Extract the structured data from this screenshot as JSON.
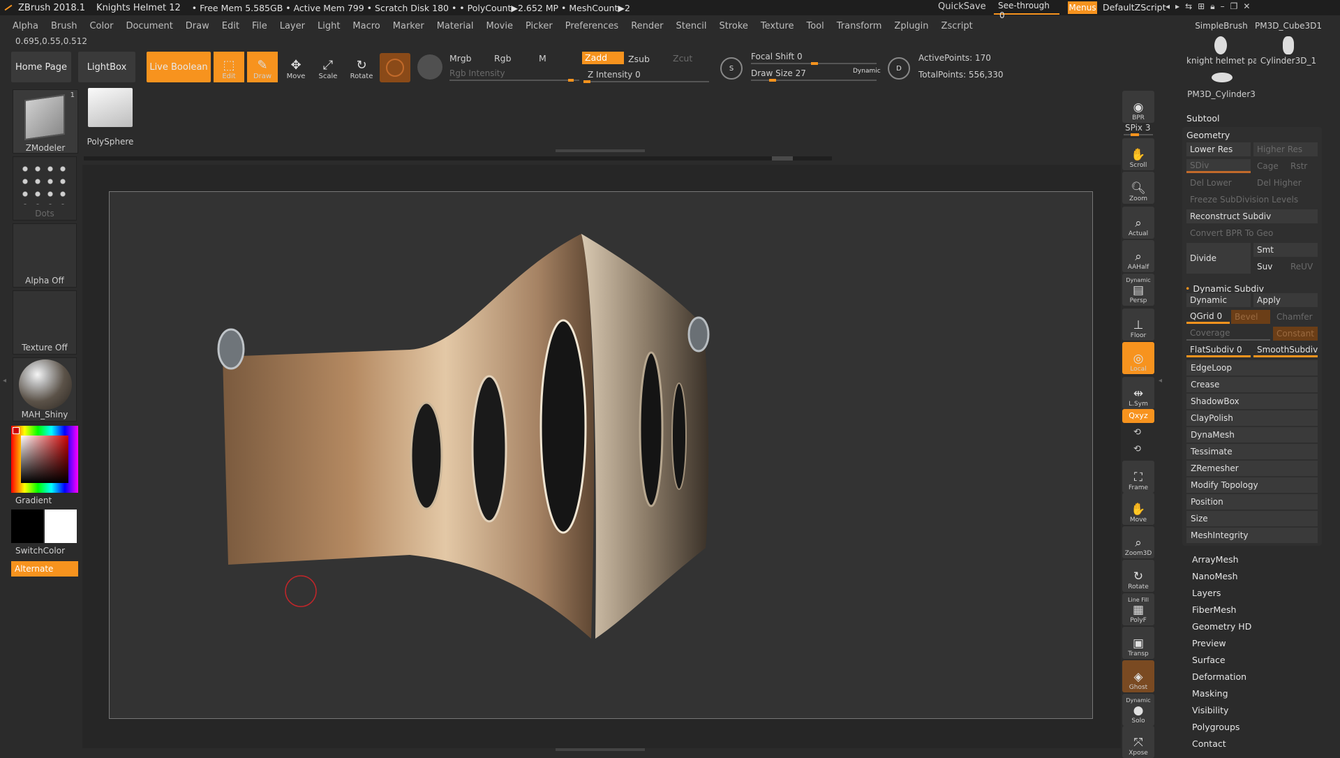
{
  "titlebar": {
    "app": "ZBrush 2018.1",
    "doc": "Knights Helmet 12",
    "stats": "• Free Mem 5.585GB • Active Mem 799 • Scratch Disk 180 • • PolyCount▶2.652 MP • MeshCount▶2",
    "quicksave": "QuickSave",
    "seethrough": "See-through",
    "seethrough_value": "0",
    "menus": "Menus",
    "script": "DefaultZScript"
  },
  "menubar": [
    "Alpha",
    "Brush",
    "Color",
    "Document",
    "Draw",
    "Edit",
    "File",
    "Layer",
    "Light",
    "Macro",
    "Marker",
    "Material",
    "Movie",
    "Picker",
    "Preferences",
    "Render",
    "Stencil",
    "Stroke",
    "Texture",
    "Tool",
    "Transform",
    "Zplugin",
    "Zscript"
  ],
  "coords": "0.695,0.55,0.512",
  "topbar": {
    "home": "Home Page",
    "lightbox": "LightBox",
    "liveboolean": "Live Boolean",
    "edit": "Edit",
    "draw": "Draw",
    "move": "Move",
    "scale": "Scale",
    "rotate": "Rotate",
    "mrgb": "Mrgb",
    "rgb": "Rgb",
    "m": "M",
    "zadd": "Zadd",
    "zsub": "Zsub",
    "zcut": "Zcut",
    "rgb_intensity": "Rgb Intensity",
    "z_intensity": "Z Intensity 0",
    "focal_shift": "Focal Shift 0",
    "draw_size": "Draw Size 27",
    "dynamic": "Dynamic",
    "active_points": "ActivePoints: 170",
    "total_points": "TotalPoints: 556,330"
  },
  "left": {
    "zmodeler": "ZModeler",
    "zmodeler_count": "1",
    "polysphere": "PolySphere",
    "dots": "Dots",
    "alpha": "Alpha Off",
    "texture": "Texture Off",
    "material": "MAH_Shiny",
    "gradient": "Gradient",
    "switchcolor": "SwitchColor",
    "alternate": "Alternate"
  },
  "shelf": {
    "bpr": "BPR",
    "spix": "SPix 3",
    "scroll": "Scroll",
    "zoom": "Zoom",
    "actual": "Actual",
    "aahalf": "AAHalf",
    "persp_top": "Dynamic",
    "persp": "Persp",
    "floor": "Floor",
    "local": "Local",
    "lsym": "L.Sym",
    "xyz": "Qxyz",
    "frame": "Frame",
    "move": "Move",
    "zoom3d": "Zoom3D",
    "rotate": "Rotate",
    "linefill": "Line Fill",
    "polyf": "PolyF",
    "transp": "Transp",
    "ghost": "Ghost",
    "solo_top": "Dynamic",
    "solo": "Solo",
    "xpose": "Xpose"
  },
  "tool_thumbs": [
    "SimpleBrush",
    "PM3D_Cube3D1",
    "knight helmet pa",
    "Cylinder3D_1",
    "PM3D_Cylinder3"
  ],
  "panel": {
    "subtool": "Subtool",
    "geometry": "Geometry",
    "lower_res": "Lower Res",
    "higher_res": "Higher Res",
    "sdiv": "SDiv",
    "cage": "Cage",
    "rstr": "Rstr",
    "del_lower": "Del Lower",
    "del_higher": "Del Higher",
    "freeze": "Freeze SubDivision Levels",
    "reconstruct": "Reconstruct Subdiv",
    "convert_bpr": "Convert BPR To Geo",
    "divide": "Divide",
    "smt": "Smt",
    "suv": "Suv",
    "reuv": "ReUV",
    "dynamic_subdiv": "Dynamic Subdiv",
    "dynamic": "Dynamic",
    "apply": "Apply",
    "qgrid": "QGrid 0",
    "bevel": "Bevel",
    "chamfer": "Chamfer",
    "coverage": "Coverage",
    "constant": "Constant",
    "flatsubdiv": "FlatSubdiv 0",
    "smoothsubdiv": "SmoothSubdiv",
    "geo_items": [
      "EdgeLoop",
      "Crease",
      "ShadowBox",
      "ClayPolish",
      "DynaMesh",
      "Tessimate",
      "ZRemesher",
      "Modify Topology",
      "Position",
      "Size",
      "MeshIntegrity"
    ],
    "menus": [
      "ArrayMesh",
      "NanoMesh",
      "Layers",
      "FiberMesh",
      "Geometry HD",
      "Preview",
      "Surface",
      "Deformation",
      "Masking",
      "Visibility",
      "Polygroups",
      "Contact"
    ]
  },
  "colors": {
    "accent": "#f7931e",
    "bg": "#2b2b2b",
    "panel": "#3a3a3a"
  }
}
